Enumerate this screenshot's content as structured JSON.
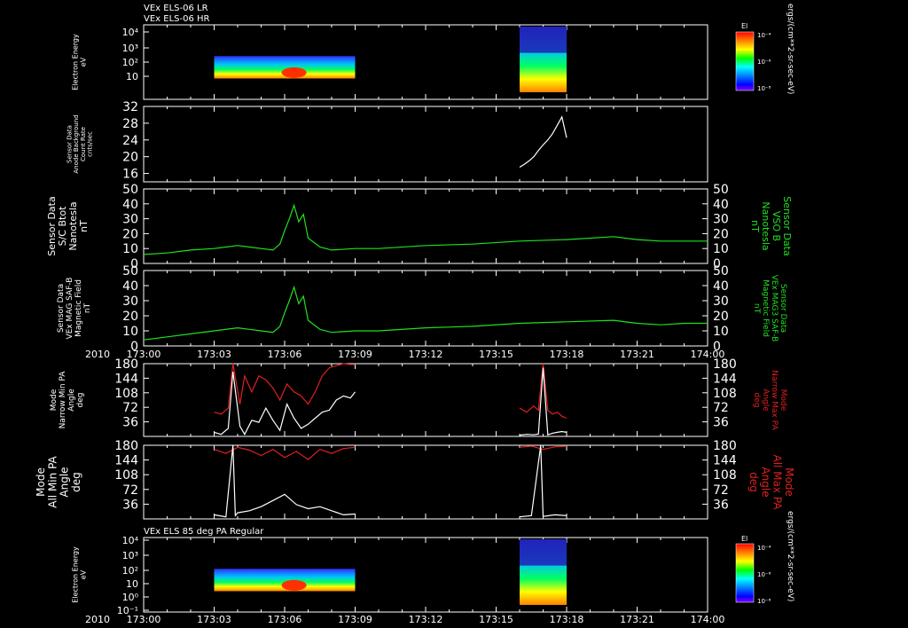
{
  "colors": {
    "background": "#000000",
    "axis": "#ffffff",
    "magnitude": "#00ff00",
    "max_pa": "#ff2020",
    "min_pa": "#ffffff"
  },
  "header": {
    "line1": "VEx ELS-06 LR",
    "line2": "VEx ELS-06 HR",
    "bottom_title": "VEx ELS 85 deg PA Regular"
  },
  "time_axis": {
    "year": "2010",
    "ticks": [
      "173:00",
      "173:03",
      "173:06",
      "173:09",
      "173:12",
      "173:15",
      "173:18",
      "173:21",
      "174:00"
    ],
    "minor_ticks_per_major": 3
  },
  "colorbar": {
    "title": "El",
    "ticks": [
      "10⁻⁴",
      "10⁻⁶",
      "10⁻⁸"
    ],
    "unit": "ergs/(cm**2-sr-sec-eV)",
    "colormap": [
      "#ff0000",
      "#ff8000",
      "#ffff00",
      "#00ff00",
      "#00ffff",
      "#0080ff",
      "#0000ff",
      "#8000ff"
    ]
  },
  "chart_data": [
    {
      "type": "heatmap",
      "panel": "els-lr-hr-spectrogram",
      "ylabel": [
        "Electron Energy",
        "eV"
      ],
      "yscale": "log",
      "yticks": [
        "10",
        "10²",
        "10³",
        "10⁴"
      ],
      "coverage": [
        {
          "start": "173:03",
          "end": "173:09"
        },
        {
          "start": "173:16",
          "end": "173:18"
        }
      ]
    },
    {
      "type": "line",
      "panel": "anode-background",
      "ylabel": [
        "Sensor Data",
        "Anode Background",
        "Count Rate",
        "cnts/sec"
      ],
      "ylim": [
        14,
        32
      ],
      "yticks": [
        "16",
        "20",
        "24",
        "28",
        "32"
      ],
      "series": [
        {
          "color": "white",
          "x": [
            16.0,
            16.2,
            16.4,
            16.6,
            16.8,
            17.0,
            17.2,
            17.4,
            17.6,
            17.8,
            18.0
          ],
          "y": [
            17.5,
            18.2,
            19.0,
            20.0,
            21.5,
            22.8,
            24.0,
            25.5,
            27.5,
            29.5,
            24.5
          ]
        }
      ]
    },
    {
      "type": "line",
      "panel": "btot",
      "ylabel": [
        "Sensor Data",
        "S/C Btot",
        "Nanotesla",
        "nT"
      ],
      "ylabel_right": [
        "Sensor Data",
        "VSO B",
        "Nanotesla",
        "nT"
      ],
      "ylim": [
        0,
        50
      ],
      "yticks": [
        "0",
        "10",
        "20",
        "30",
        "40",
        "50"
      ],
      "series": [
        {
          "color": "green",
          "x": [
            0,
            1,
            2,
            3,
            4,
            4.5,
            5,
            5.5,
            5.8,
            6.0,
            6.2,
            6.4,
            6.6,
            6.8,
            7.0,
            7.5,
            8,
            9,
            10,
            12,
            14,
            16,
            18,
            20,
            21,
            22,
            23,
            24
          ],
          "y": [
            6,
            7,
            9,
            10,
            12,
            11,
            10,
            9,
            13,
            22,
            30,
            39,
            28,
            33,
            17,
            11,
            9,
            10,
            10,
            12,
            13,
            15,
            16,
            18,
            16,
            15,
            15,
            15
          ]
        }
      ]
    },
    {
      "type": "line",
      "panel": "mag-saf",
      "ylabel": [
        "Sensor Data",
        "VEx MAG SAF-B",
        "Magnetic Field",
        "nT"
      ],
      "ylabel_right": [
        "Sensor Data",
        "VEx MAG3 SAF-B",
        "Magnetic Field",
        "nT"
      ],
      "ylim": [
        0,
        50
      ],
      "yticks": [
        "0",
        "10",
        "20",
        "30",
        "40",
        "50"
      ],
      "series": [
        {
          "color": "green",
          "x": [
            0,
            1,
            2,
            3,
            4,
            4.5,
            5,
            5.5,
            5.8,
            6.0,
            6.2,
            6.4,
            6.6,
            6.8,
            7.0,
            7.5,
            8,
            9,
            10,
            12,
            14,
            16,
            18,
            20,
            21,
            22,
            23,
            24
          ],
          "y": [
            4,
            6,
            8,
            10,
            12,
            11,
            10,
            9,
            13,
            22,
            30,
            39,
            28,
            33,
            17,
            11,
            9,
            10,
            10,
            12,
            13,
            15,
            16,
            17,
            15,
            14,
            15,
            15
          ]
        }
      ]
    },
    {
      "type": "line",
      "panel": "narrow-pa",
      "ylabel": [
        "Mode",
        "Narrow Min PA",
        "Angle",
        "deg"
      ],
      "ylabel_right": [
        "Mode",
        "Narrow Max PA",
        "Angle",
        "deg"
      ],
      "ylim": [
        0,
        180
      ],
      "yticks": [
        "36",
        "72",
        "108",
        "144",
        "180"
      ],
      "yticks_right": [
        "36",
        "72",
        "108",
        "144",
        "180"
      ],
      "series": [
        {
          "name": "Narrow Max PA",
          "color": "red",
          "x": [
            3.0,
            3.3,
            3.6,
            3.8,
            4.1,
            4.3,
            4.6,
            4.9,
            5.2,
            5.5,
            5.8,
            6.1,
            6.4,
            6.7,
            7.0,
            7.3,
            7.6,
            7.9,
            8.2,
            8.5,
            8.8,
            9.0
          ],
          "y": [
            60,
            55,
            70,
            180,
            80,
            150,
            110,
            150,
            140,
            120,
            90,
            130,
            110,
            100,
            80,
            110,
            150,
            170,
            175,
            180,
            178,
            178
          ]
        },
        {
          "name": "Narrow Min PA",
          "color": "white",
          "x": [
            3.0,
            3.3,
            3.6,
            3.8,
            4.1,
            4.3,
            4.6,
            4.9,
            5.2,
            5.5,
            5.8,
            6.1,
            6.4,
            6.7,
            7.0,
            7.3,
            7.6,
            7.9,
            8.2,
            8.5,
            8.8,
            9.0
          ],
          "y": [
            10,
            5,
            20,
            160,
            25,
            5,
            40,
            35,
            70,
            40,
            15,
            80,
            45,
            20,
            30,
            45,
            60,
            65,
            90,
            100,
            95,
            110
          ]
        },
        {
          "name": "Narrow Max PA",
          "color": "red",
          "x": [
            16.0,
            16.3,
            16.6,
            16.8,
            17.0,
            17.2,
            17.4,
            17.6,
            17.8,
            18.0
          ],
          "y": [
            70,
            60,
            75,
            65,
            180,
            65,
            55,
            60,
            50,
            45
          ]
        },
        {
          "name": "Narrow Min PA",
          "color": "white",
          "x": [
            16.0,
            16.3,
            16.6,
            16.8,
            17.0,
            17.2,
            17.4,
            17.6,
            17.8,
            18.0
          ],
          "y": [
            3,
            5,
            4,
            6,
            170,
            4,
            8,
            10,
            12,
            10
          ]
        }
      ]
    },
    {
      "type": "line",
      "panel": "all-pa",
      "ylabel": [
        "Mode",
        "All Min PA",
        "Angle",
        "deg"
      ],
      "ylabel_right": [
        "Mode",
        "All Max PA",
        "Angle",
        "deg"
      ],
      "ylim": [
        0,
        180
      ],
      "yticks": [
        "36",
        "72",
        "108",
        "144",
        "180"
      ],
      "yticks_right": [
        "36",
        "72",
        "108",
        "144",
        "180"
      ],
      "series": [
        {
          "name": "All Max PA",
          "color": "red",
          "x": [
            3.0,
            3.5,
            4.0,
            4.5,
            5.0,
            5.5,
            6.0,
            6.5,
            7.0,
            7.5,
            8.0,
            8.5,
            9.0
          ],
          "y": [
            170,
            160,
            175,
            168,
            155,
            170,
            150,
            165,
            145,
            170,
            160,
            172,
            175
          ]
        },
        {
          "name": "All Min PA",
          "color": "white",
          "x": [
            3.0,
            3.5,
            3.8,
            3.9,
            4.0,
            4.5,
            5.0,
            5.5,
            6.0,
            6.5,
            7.0,
            7.5,
            8.0,
            8.5,
            9.0
          ],
          "y": [
            10,
            5,
            180,
            8,
            15,
            20,
            30,
            45,
            60,
            35,
            25,
            30,
            20,
            10,
            12
          ]
        },
        {
          "name": "All Max PA",
          "color": "red",
          "x": [
            16.0,
            16.5,
            17.0,
            17.5,
            18.0
          ],
          "y": [
            175,
            178,
            170,
            176,
            178
          ]
        },
        {
          "name": "All Min PA",
          "color": "white",
          "x": [
            16.0,
            16.5,
            16.9,
            17.0,
            17.5,
            18.0
          ],
          "y": [
            5,
            8,
            180,
            6,
            10,
            8
          ]
        }
      ]
    },
    {
      "type": "heatmap",
      "panel": "els-85deg-spectrogram",
      "ylabel": [
        "Electron Energy",
        "eV"
      ],
      "yscale": "log",
      "yticks": [
        "10⁻¹",
        "10⁰",
        "10",
        "10²",
        "10³",
        "10⁴"
      ],
      "coverage": [
        {
          "start": "173:03",
          "end": "173:09"
        },
        {
          "start": "173:16",
          "end": "173:18"
        }
      ]
    }
  ]
}
